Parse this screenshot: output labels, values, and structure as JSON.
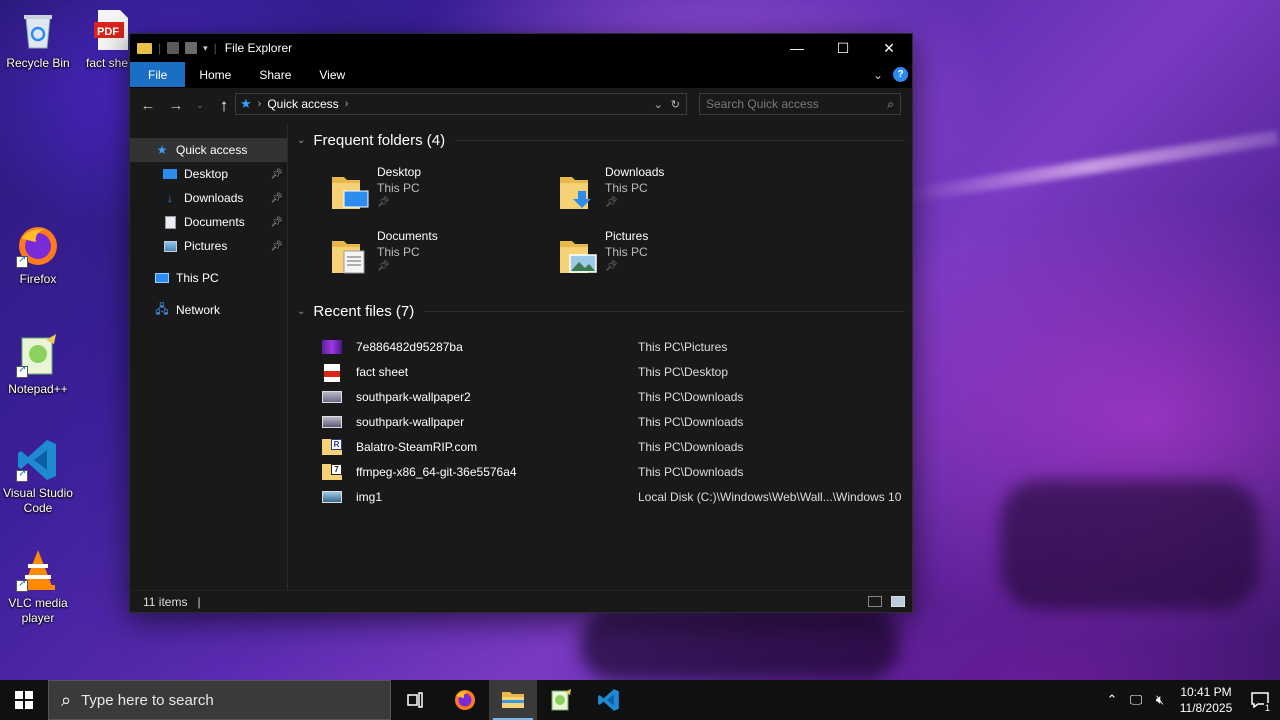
{
  "desktop": {
    "icons": [
      {
        "label": "Recycle Bin"
      },
      {
        "label": "fact she"
      },
      {
        "label": "Firefox"
      },
      {
        "label": "Notepad++"
      },
      {
        "label": "Visual Studio Code"
      },
      {
        "label": "VLC media player"
      }
    ],
    "pdf_badge": "PDF"
  },
  "window": {
    "title": "File Explorer",
    "ribbon_tabs": [
      "File",
      "Home",
      "Share",
      "View"
    ],
    "help_label": "?",
    "address": {
      "crumb": "Quick access"
    },
    "search_placeholder": "Search Quick access",
    "accent": "#1a6fc4"
  },
  "nav_pane": {
    "quick_access": "Quick access",
    "items": [
      {
        "label": "Desktop",
        "pinned": true
      },
      {
        "label": "Downloads",
        "pinned": true
      },
      {
        "label": "Documents",
        "pinned": true
      },
      {
        "label": "Pictures",
        "pinned": true
      }
    ],
    "this_pc": "This PC",
    "network": "Network"
  },
  "frequent": {
    "header": "Frequent folders (4)",
    "folders": [
      {
        "name": "Desktop",
        "location": "This PC",
        "icon": "desktop-folder-icon"
      },
      {
        "name": "Downloads",
        "location": "This PC",
        "icon": "downloads-folder-icon"
      },
      {
        "name": "Documents",
        "location": "This PC",
        "icon": "documents-folder-icon"
      },
      {
        "name": "Pictures",
        "location": "This PC",
        "icon": "pictures-folder-icon"
      }
    ]
  },
  "recent": {
    "header": "Recent files (7)",
    "files": [
      {
        "name": "7e886482d95287ba",
        "path": "This PC\\Pictures",
        "icon": "image-icon"
      },
      {
        "name": "fact sheet",
        "path": "This PC\\Desktop",
        "icon": "pdf-icon"
      },
      {
        "name": "southpark-wallpaper2",
        "path": "This PC\\Downloads",
        "icon": "image-icon"
      },
      {
        "name": "southpark-wallpaper",
        "path": "This PC\\Downloads",
        "icon": "image-icon"
      },
      {
        "name": "Balatro-SteamRIP.com",
        "path": "This PC\\Downloads",
        "icon": "rar-archive-icon"
      },
      {
        "name": "ffmpeg-x86_64-git-36e5576a4",
        "path": "This PC\\Downloads",
        "icon": "7z-archive-icon"
      },
      {
        "name": "img1",
        "path": "Local Disk (C:)\\Windows\\Web\\Wall...\\Windows 10",
        "icon": "image-icon"
      }
    ]
  },
  "status": {
    "items": "11 items",
    "separator": "|"
  },
  "taskbar": {
    "search_placeholder": "Type here to search",
    "time": "10:41 PM",
    "date": "11/8/2025",
    "notification_count": "1"
  }
}
